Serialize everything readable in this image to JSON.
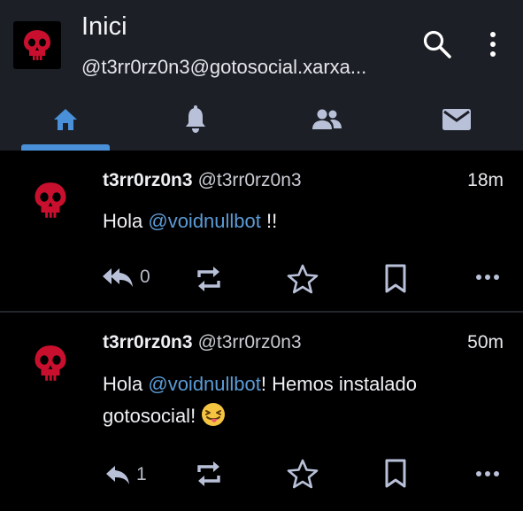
{
  "header": {
    "title": "Inici",
    "handle": "@t3rr0rz0n3@gotosocial.xarxa..."
  },
  "tabs": [
    {
      "name": "home",
      "icon": "home-icon",
      "active": true
    },
    {
      "name": "notifications",
      "icon": "bell-icon",
      "active": false
    },
    {
      "name": "people",
      "icon": "people-icon",
      "active": false
    },
    {
      "name": "messages",
      "icon": "mail-icon",
      "active": false
    }
  ],
  "posts": [
    {
      "display_name": "t3rr0rz0n3",
      "acct": "@t3rr0rz0n3",
      "time": "18m",
      "text_before": "Hola ",
      "mention": "@voidnullbot",
      "text_after": " !!",
      "reply_count": "0"
    },
    {
      "display_name": "t3rr0rz0n3",
      "acct": "@t3rr0rz0n3",
      "time": "50m",
      "text_before": "Hola ",
      "mention": "@voidnullbot",
      "text_after": "! Hemos instalado gotosocial!",
      "reply_count": "1"
    }
  ],
  "colors": {
    "header_bg": "#1c1f26",
    "accent": "#4a90d9",
    "mention": "#5b9bd5",
    "icon": "#b9c1d9",
    "skull": "#c8102e"
  }
}
